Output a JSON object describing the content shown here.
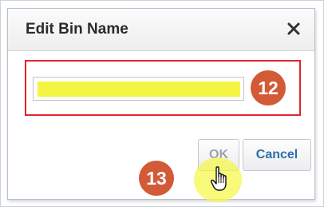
{
  "dialog": {
    "title": "Edit Bin Name",
    "close_icon": "close-x-icon",
    "name_field": {
      "value": "",
      "highlight_color": "#f4f542"
    }
  },
  "buttons": {
    "ok_label": "OK",
    "cancel_label": "Cancel"
  },
  "annotations": {
    "step_12": "12",
    "step_13": "13",
    "highlight_border_color": "#e0262a",
    "callout_color": "#d35a36",
    "cursor_icon": "hand-pointer-icon"
  }
}
